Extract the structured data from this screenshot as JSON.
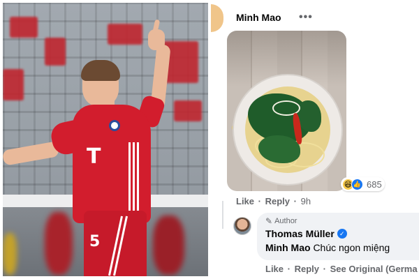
{
  "post": {
    "author_name": "Minh Mao",
    "more_icon": "ellipsis-icon",
    "photo_subject": "noodle-bowl-photo",
    "reactions": {
      "icons": [
        "haha-icon",
        "like-icon"
      ],
      "count": "685"
    },
    "actions": {
      "like": "Like",
      "reply": "Reply",
      "time": "9h"
    }
  },
  "reply": {
    "badge": "Author",
    "badge_icon": "pencil-icon",
    "name": "Thomas Müller",
    "verified_icon": "verified-icon",
    "mention": "Minh Mao",
    "text": "Chúc ngon miệng",
    "actions": {
      "like": "Like",
      "reply": "Reply",
      "see_original": "See Original (Germa"
    }
  },
  "photo": {
    "subject": "player-photo",
    "jersey_text": "T",
    "shorts_number": "5"
  },
  "colors": {
    "jersey": "#d21d2d",
    "link_blue": "#1877f2",
    "secondary_text": "#65676b",
    "bubble": "#f0f2f5"
  }
}
